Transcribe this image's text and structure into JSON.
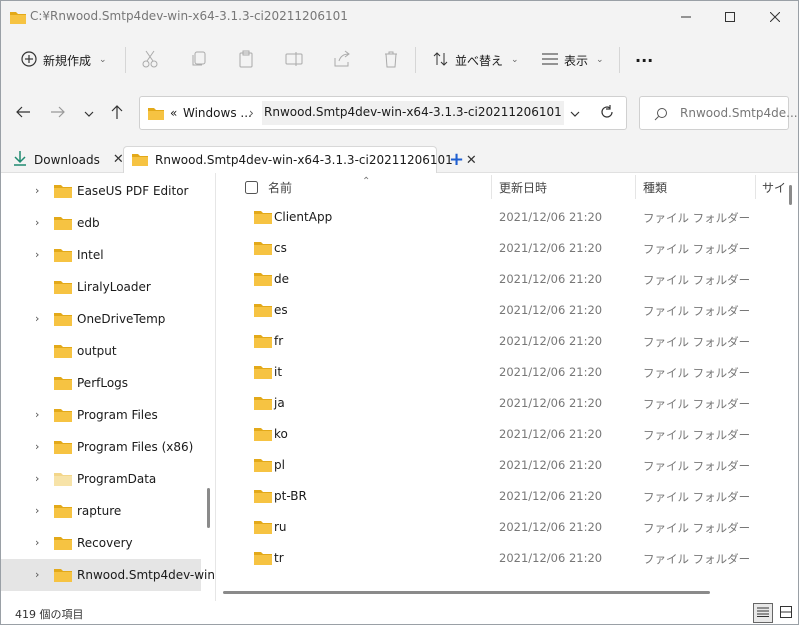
{
  "window": {
    "title": "C:¥Rnwood.Smtp4dev-win-x64-3.1.3-ci20211206101"
  },
  "commandbar": {
    "new_label": "新規作成",
    "sort_label": "並べ替え",
    "view_label": "表示",
    "more_label": "···"
  },
  "address": {
    "overflow": "«",
    "crumb1": "Windows ...",
    "current": "Rnwood.Smtp4dev-win-x64-3.1.3-ci20211206101"
  },
  "search": {
    "placeholder": "Rnwood.Smtp4de..."
  },
  "tabs": [
    {
      "label": "Downloads"
    },
    {
      "label": "Rnwood.Smtp4dev-win-x64-3.1.3-ci20211206101"
    }
  ],
  "nav_tree": [
    {
      "label": "EaseUS PDF Editor",
      "chevron": true
    },
    {
      "label": "edb",
      "chevron": true
    },
    {
      "label": "Intel",
      "chevron": true
    },
    {
      "label": "LiralyLoader",
      "chevron": false
    },
    {
      "label": "OneDriveTemp",
      "chevron": true
    },
    {
      "label": "output",
      "chevron": false
    },
    {
      "label": "PerfLogs",
      "chevron": false
    },
    {
      "label": "Program Files",
      "chevron": true
    },
    {
      "label": "Program Files (x86)",
      "chevron": true
    },
    {
      "label": "ProgramData",
      "chevron": true
    },
    {
      "label": "rapture",
      "chevron": true
    },
    {
      "label": "Recovery",
      "chevron": true
    },
    {
      "label": "Rnwood.Smtp4dev-win",
      "chevron": true
    }
  ],
  "columns": {
    "name": "名前",
    "date": "更新日時",
    "type": "種類",
    "size": "サイ"
  },
  "files": [
    {
      "name": "ClientApp",
      "date": "2021/12/06 21:20",
      "type": "ファイル フォルダー"
    },
    {
      "name": "cs",
      "date": "2021/12/06 21:20",
      "type": "ファイル フォルダー"
    },
    {
      "name": "de",
      "date": "2021/12/06 21:20",
      "type": "ファイル フォルダー"
    },
    {
      "name": "es",
      "date": "2021/12/06 21:20",
      "type": "ファイル フォルダー"
    },
    {
      "name": "fr",
      "date": "2021/12/06 21:20",
      "type": "ファイル フォルダー"
    },
    {
      "name": "it",
      "date": "2021/12/06 21:20",
      "type": "ファイル フォルダー"
    },
    {
      "name": "ja",
      "date": "2021/12/06 21:20",
      "type": "ファイル フォルダー"
    },
    {
      "name": "ko",
      "date": "2021/12/06 21:20",
      "type": "ファイル フォルダー"
    },
    {
      "name": "pl",
      "date": "2021/12/06 21:20",
      "type": "ファイル フォルダー"
    },
    {
      "name": "pt-BR",
      "date": "2021/12/06 21:20",
      "type": "ファイル フォルダー"
    },
    {
      "name": "ru",
      "date": "2021/12/06 21:20",
      "type": "ファイル フォルダー"
    },
    {
      "name": "tr",
      "date": "2021/12/06 21:20",
      "type": "ファイル フォルダー"
    }
  ],
  "status": {
    "count": "419 個の項目"
  },
  "colors": {
    "folder": "#f6c342",
    "folder_dark": "#e3a919",
    "download_accent": "#1f8a70",
    "add_tab": "#1f5fd1"
  }
}
